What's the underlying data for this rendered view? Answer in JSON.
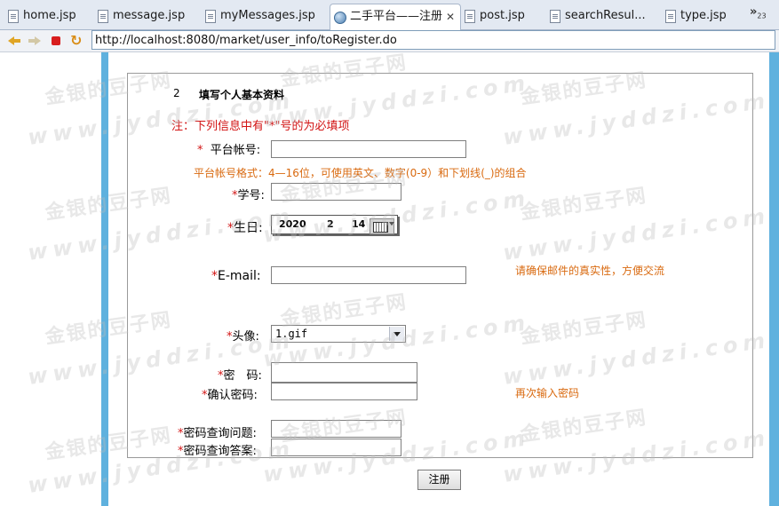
{
  "tabs": [
    {
      "label": "home.jsp"
    },
    {
      "label": "message.jsp"
    },
    {
      "label": "myMessages.jsp"
    },
    {
      "label": "二手平台——注册",
      "active": true
    },
    {
      "label": "post.jsp"
    },
    {
      "label": "searchResul..."
    },
    {
      "label": "type.jsp"
    }
  ],
  "tab_overflow": {
    "symbol": "»",
    "count": "23"
  },
  "browser": {
    "url": "http://localhost:8080/market/user_info/toRegister.do"
  },
  "form": {
    "step_number": "2",
    "step_title": "填写个人基本资料",
    "notice": "注：下列信息中有\"*\"号的为必填项",
    "required_mark": "*",
    "account": {
      "label": "平台帐号:",
      "value": "",
      "hint": "平台帐号格式：4—16位，可使用英文、数字(0-9）和下划线(_)的组合"
    },
    "student_id": {
      "label": "学号:",
      "value": ""
    },
    "birthday": {
      "label": "生日:",
      "year": "2020",
      "month": "2",
      "day": "14"
    },
    "email": {
      "label": "E-mail:",
      "value": "",
      "hint": "请确保邮件的真实性，方便交流"
    },
    "avatar": {
      "label": "头像:",
      "selected": "1.gif"
    },
    "password": {
      "label": "密　码:",
      "value": ""
    },
    "confirm_password": {
      "label": "确认密码:",
      "value": "",
      "hint": "再次输入密码"
    },
    "security_question": {
      "label": "密码查询问题:",
      "value": ""
    },
    "security_answer": {
      "label": "密码查询答案:",
      "value": ""
    },
    "submit_label": "注册"
  },
  "watermark": {
    "cn": "金银的豆子网",
    "en": "www.jyddzi.com"
  },
  "colors": {
    "required": "#d21414",
    "hint": "#d96a10",
    "side_bar": "#5fb1de"
  }
}
